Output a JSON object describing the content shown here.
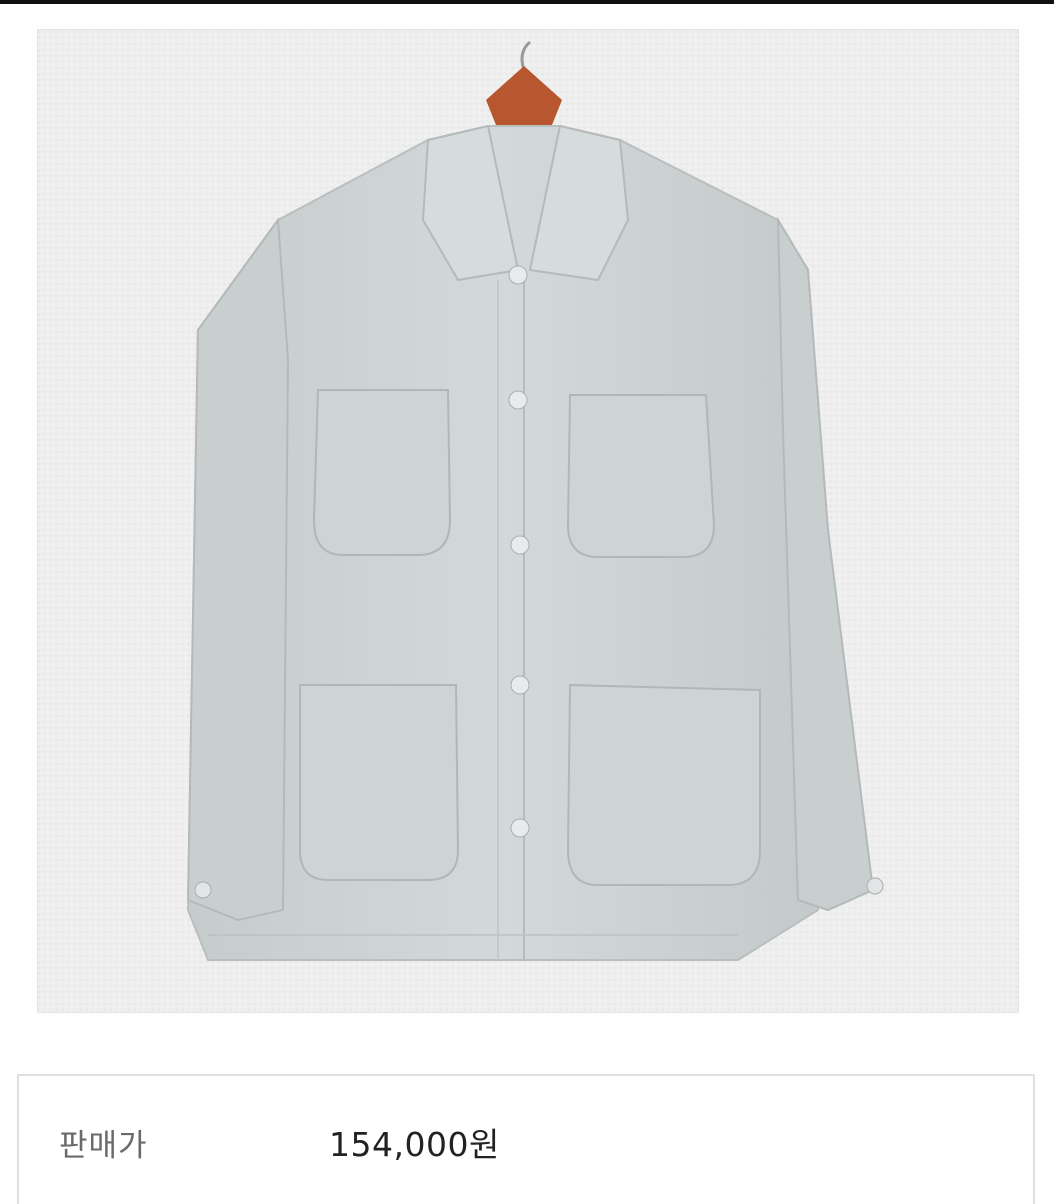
{
  "product": {
    "image_subject": "jacket-on-hanger",
    "price_label": "판매가",
    "price_value": "154,000원"
  },
  "colors": {
    "jacket": "#cdd3d3",
    "wall": "#eeeeee",
    "hanger": "#b8562f",
    "border": "#e0e0e0"
  }
}
